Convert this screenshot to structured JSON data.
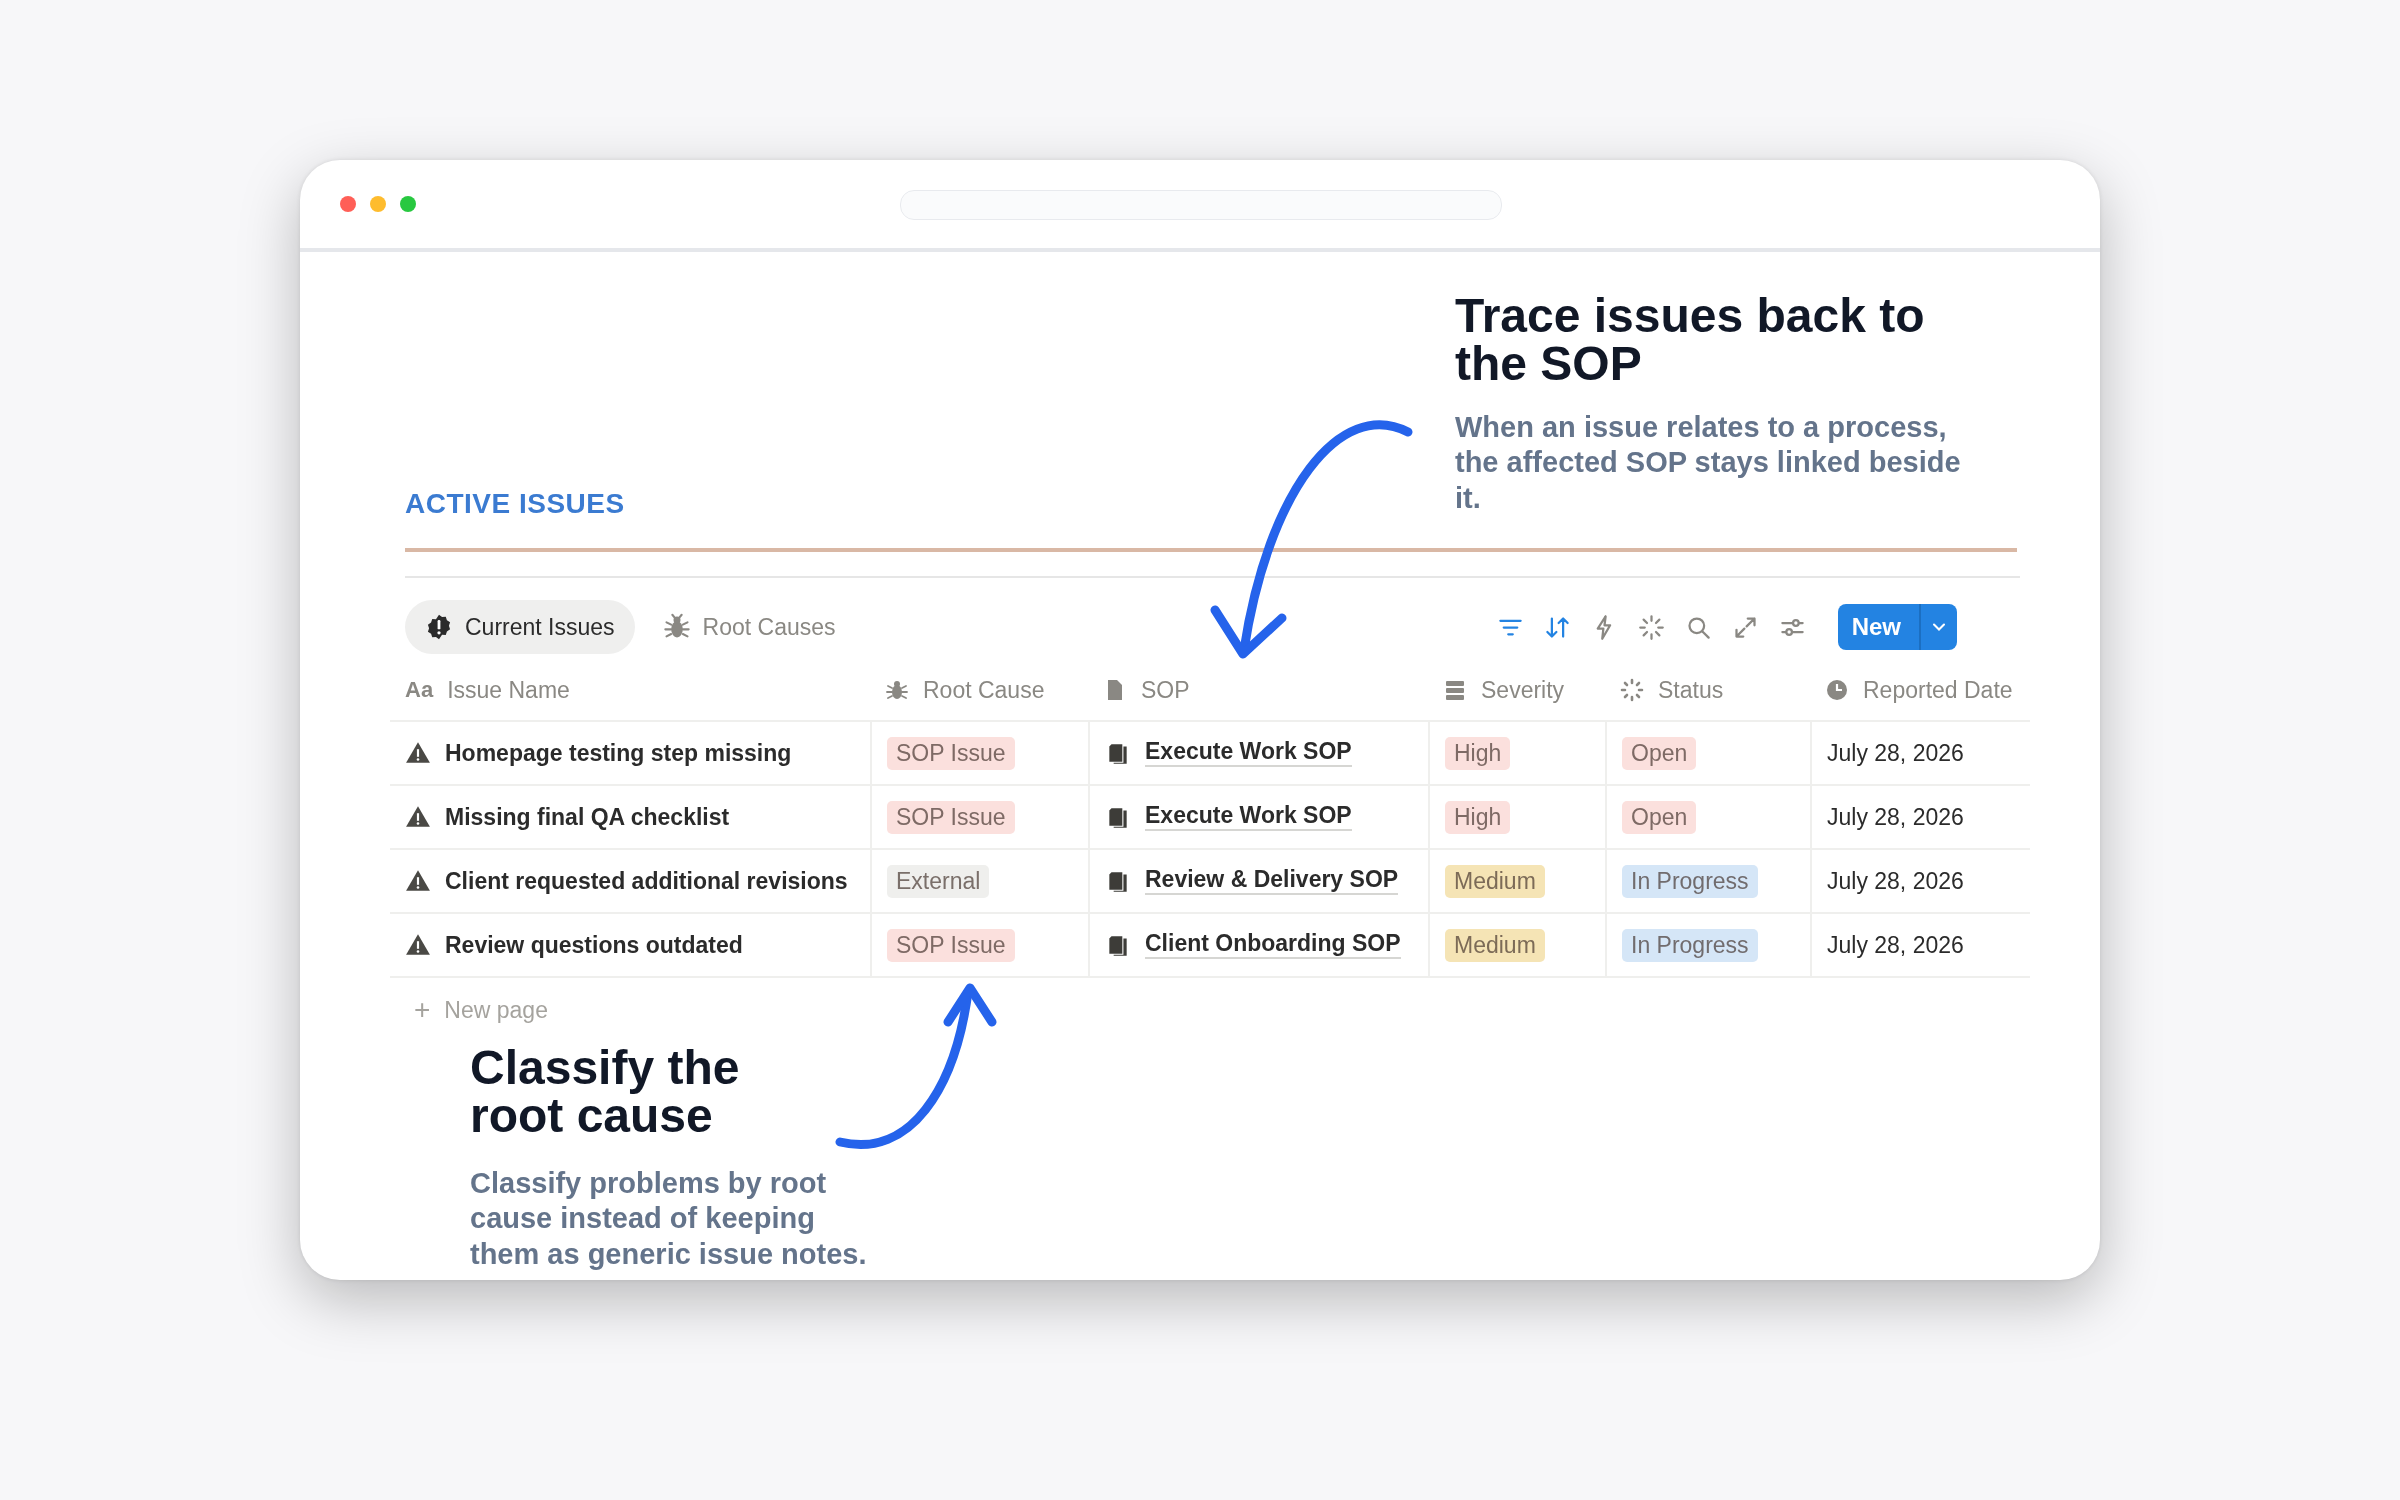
{
  "section_title": "ACTIVE ISSUES",
  "tabs": [
    {
      "label": "Current Issues",
      "selected": true
    },
    {
      "label": "Root Causes",
      "selected": false
    }
  ],
  "toolbar": [
    {
      "kind": "filter",
      "active": true
    },
    {
      "kind": "sort",
      "active": true
    },
    {
      "kind": "bolt",
      "active": false
    },
    {
      "kind": "sparkle",
      "active": false
    },
    {
      "kind": "search",
      "active": false
    },
    {
      "kind": "expand",
      "active": false
    },
    {
      "kind": "sliders",
      "active": false
    }
  ],
  "new_button": {
    "label": "New"
  },
  "table": {
    "columns": [
      {
        "label": "Issue Name",
        "glyph": "Aa"
      },
      {
        "label": "Root Cause"
      },
      {
        "label": "SOP"
      },
      {
        "label": "Severity"
      },
      {
        "label": "Status"
      },
      {
        "label": "Reported Date"
      }
    ],
    "rows": [
      {
        "name": "Homepage testing step missing",
        "root_cause": {
          "label": "SOP Issue",
          "color": "#fbe0dd"
        },
        "sop": "Execute Work SOP",
        "severity": {
          "label": "High",
          "color": "#fbe0dd"
        },
        "status": {
          "label": "Open",
          "color": "#fbe0dd"
        },
        "date": "July 28, 2026"
      },
      {
        "name": "Missing final QA checklist",
        "root_cause": {
          "label": "SOP Issue",
          "color": "#fbe0dd"
        },
        "sop": "Execute Work SOP",
        "severity": {
          "label": "High",
          "color": "#fbe0dd"
        },
        "status": {
          "label": "Open",
          "color": "#fbe0dd"
        },
        "date": "July 28, 2026"
      },
      {
        "name": "Client requested additional revisions",
        "root_cause": {
          "label": "External",
          "color": "#efefed"
        },
        "sop": "Review & Delivery SOP",
        "severity": {
          "label": "Medium",
          "color": "#f5e4b5"
        },
        "status": {
          "label": "In Progress",
          "color": "#d5e6f7"
        },
        "date": "July 28, 2026"
      },
      {
        "name": "Review questions outdated",
        "root_cause": {
          "label": "SOP Issue",
          "color": "#fbe0dd"
        },
        "sop": "Client Onboarding SOP",
        "severity": {
          "label": "Medium",
          "color": "#f5e4b5"
        },
        "status": {
          "label": "In Progress",
          "color": "#d5e6f7"
        },
        "date": "July 28, 2026"
      }
    ],
    "new_row": {
      "icon": "+",
      "label": "New page"
    }
  },
  "callouts": [
    {
      "title": "Trace issues back to the SOP",
      "text": "When an issue relates to a process, the affected SOP stays linked beside it."
    },
    {
      "title": "Classify the root cause",
      "text": "Classify problems by root cause instead of keeping them as generic issue notes."
    }
  ]
}
